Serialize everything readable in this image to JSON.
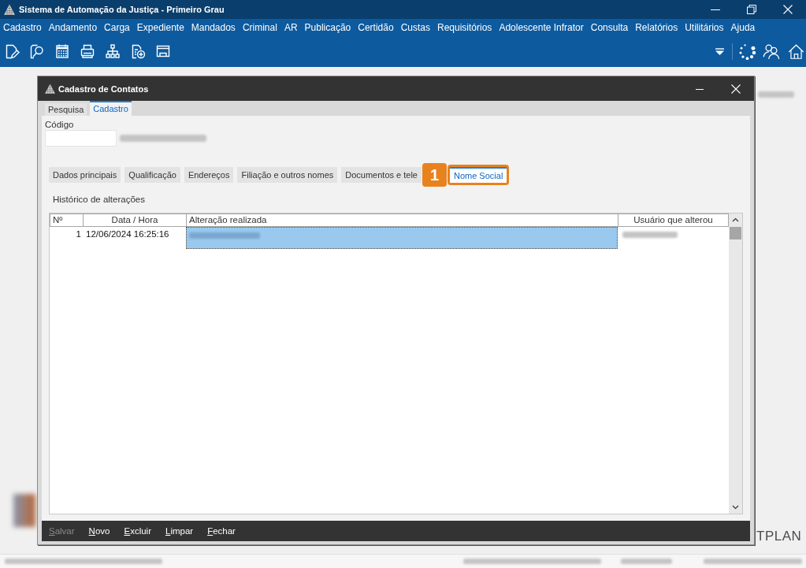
{
  "window": {
    "title": "Sistema de Automação da Justiça - Primeiro Grau"
  },
  "menu": [
    "Cadastro",
    "Andamento",
    "Carga",
    "Expediente",
    "Mandados",
    "Criminal",
    "AR",
    "Publicação",
    "Certidão",
    "Custas",
    "Requisitórios",
    "Adolescente Infrator",
    "Consulta",
    "Relatórios",
    "Utilitários",
    "Ajuda"
  ],
  "dialog": {
    "title": "Cadastro de Contatos",
    "tabs": [
      {
        "label": "Pesquisa",
        "selected": false
      },
      {
        "label": "Cadastro",
        "selected": true
      }
    ],
    "code_field": {
      "label": "Código"
    },
    "section_tabs": [
      {
        "label": "Dados principais",
        "selected": false
      },
      {
        "label": "Qualificação",
        "selected": false
      },
      {
        "label": "Endereços",
        "selected": false
      },
      {
        "label": "Filiação e outros nomes",
        "selected": false
      },
      {
        "label": "Documentos e tele",
        "selected": false
      },
      {
        "label": "Nome Social",
        "selected": true,
        "callout": "1"
      }
    ],
    "history": {
      "title": "Histórico de alterações",
      "columns": [
        "Nº",
        "Data / Hora",
        "Alteração realizada",
        "Usuário que alterou"
      ],
      "rows": [
        {
          "number": "1",
          "date_time": "12/06/2024 16:25:16",
          "selected": true
        }
      ]
    },
    "buttons": [
      {
        "label": "Salvar",
        "disabled": true
      },
      {
        "label": "Novo",
        "disabled": false
      },
      {
        "label": "Excluir",
        "disabled": false
      },
      {
        "label": "Limpar",
        "disabled": false
      },
      {
        "label": "Fechar",
        "disabled": false
      }
    ]
  },
  "background": {
    "logo_text": "TPLAN"
  }
}
